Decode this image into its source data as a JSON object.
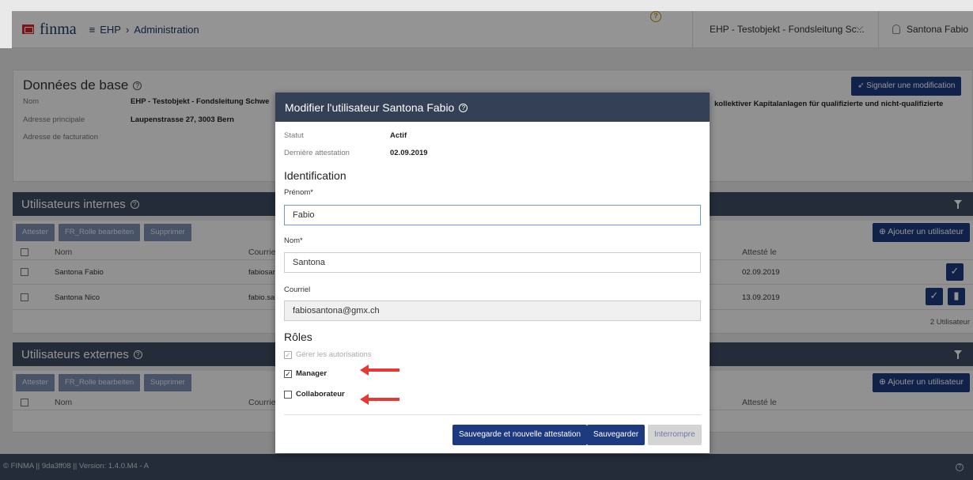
{
  "header": {
    "logo": "finma",
    "breadcrumb": [
      "EHP",
      "Administration"
    ],
    "context": "EHP - Testobjekt - Fondsleitung Sc...",
    "user": "Santona Fabio"
  },
  "base": {
    "title": "Données de base",
    "report_button": "Signaler une modification",
    "labels": [
      "Nom",
      "Adresse principale",
      "Adresse de facturation"
    ],
    "name": "EHP - Testobjekt - Fondsleitung Schwe",
    "address": "Laupenstrasse 27, 3003 Bern",
    "right_text": "kollektiver Kapitalanlagen für qualifizierte und nicht-qualifizierte"
  },
  "internal": {
    "title": "Utilisateurs internes",
    "buttons": [
      "Attester",
      "FR_Rolle bearbeiten",
      "Supprimer"
    ],
    "add": "Ajouter un utilisateur",
    "col_name": "Nom",
    "col_mail": "Courrie",
    "col_attest": "Attesté le",
    "rows": [
      {
        "name": "Santona Fabio",
        "mail": "fabiosar",
        "date": "02.09.2019"
      },
      {
        "name": "Santona Nico",
        "mail": "fabio.sa",
        "date": "13.09.2019"
      }
    ],
    "count": "2 Utilisateur"
  },
  "external": {
    "title": "Utilisateurs externes",
    "buttons": [
      "Attester",
      "FR_Rolle bearbeiten",
      "Supprimer"
    ],
    "add": "Ajouter un utilisateur",
    "col_name": "Nom",
    "col_mail": "Courrie",
    "col_attest": "Attesté le"
  },
  "footer": "© FINMA || 9da3ff08 || Version: 1.4.0.M4 - A",
  "modal": {
    "title": "Modifier l'utilisateur Santona Fabio",
    "status_label": "Statut",
    "status_value": "Actif",
    "attest_label": "Dernière attestation",
    "attest_value": "02.09.2019",
    "identification": "Identification",
    "firstname_label": "Prénom*",
    "firstname_value": "Fabio",
    "lastname_label": "Nom*",
    "lastname_value": "Santona",
    "email_label": "Courriel",
    "email_value": "fabiosantona@gmx.ch",
    "roles": "Rôles",
    "role_admin": "Gérer les autorisations",
    "role_manager": "Manager",
    "role_collab": "Collaborateur",
    "btn_save_attest": "Sauvegarde et nouvelle attestation",
    "btn_save": "Sauvegarder",
    "btn_cancel": "Interrompre"
  },
  "colors": {
    "primary": "#1d3a80",
    "header": "#334055",
    "annotation_arrow": "#e53935"
  }
}
